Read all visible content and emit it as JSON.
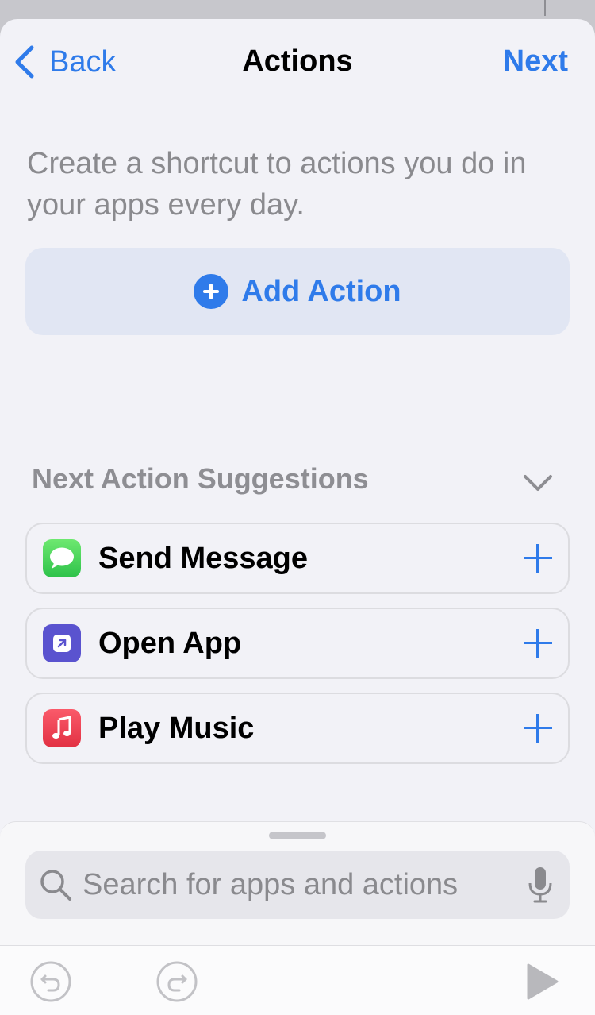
{
  "nav": {
    "back_label": "Back",
    "title": "Actions",
    "next_label": "Next"
  },
  "intro_text": "Create a shortcut to actions you do in your apps every day.",
  "add_action_label": "Add Action",
  "suggestions": {
    "header": "Next Action Suggestions",
    "items": [
      {
        "label": "Send Message",
        "icon": "messages-icon",
        "color": "#34c759"
      },
      {
        "label": "Open App",
        "icon": "open-app-icon",
        "color": "#5856d6"
      },
      {
        "label": "Play Music",
        "icon": "music-icon",
        "color": "#fc3c44"
      }
    ]
  },
  "search": {
    "placeholder": "Search for apps and actions"
  },
  "colors": {
    "accent": "#2f7bea",
    "background": "#f2f2f7",
    "secondary_text": "#8a8a8e"
  }
}
